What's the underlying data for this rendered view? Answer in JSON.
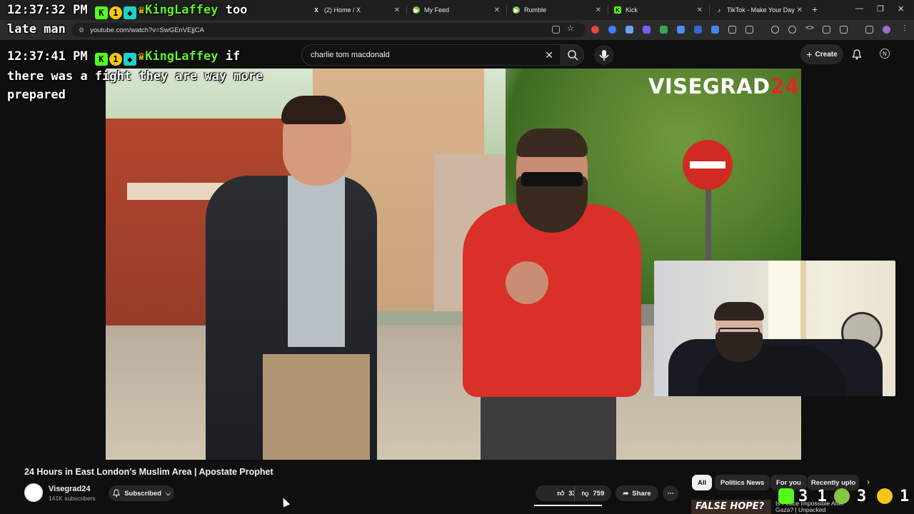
{
  "tabs": [
    {
      "label": "(2) Home / X",
      "icon": "x-icon"
    },
    {
      "label": "My Feed",
      "icon": "rumble-icon"
    },
    {
      "label": "Rumble",
      "icon": "rumble-icon"
    },
    {
      "label": "Kick",
      "icon": "kick-icon"
    },
    {
      "label": "TikTok - Make Your Day",
      "icon": "tiktok-icon"
    }
  ],
  "address": {
    "url": "youtube.com/watch?v=SwGEnVEjjCA"
  },
  "search": {
    "query": "charlie tom macdonald"
  },
  "header": {
    "create_label": "Create",
    "account_initial": "N"
  },
  "chat": [
    {
      "time": "12:37:32 PM",
      "user": "KingLaffey",
      "text": "too",
      "continuation": "late man"
    },
    {
      "time": "12:37:41 PM",
      "user": "KingLaffey",
      "text": "if",
      "continuation1": "there was a fight they are way more",
      "continuation2": "prepared"
    }
  ],
  "video": {
    "watermark_text": "VISEGRAD",
    "watermark_num": "24",
    "title": "24 Hours in East London's Muslim Area | Apostate Prophet"
  },
  "channel": {
    "name": "Visegrad24",
    "subscribers": "141K subscribers",
    "subscribe_label": "Subscribed"
  },
  "actions": {
    "likes": "33K",
    "dislikes": "759",
    "share_label": "Share"
  },
  "chips": [
    "All",
    "Politics News",
    "For you",
    "Recently uplo"
  ],
  "sidebar_video": {
    "thumb_text": "FALSE HOPE?",
    "title": "Is Peace Impossible After Gaza? | Unpacked"
  },
  "counters": {
    "kick": "3 1",
    "rumble": "3",
    "other": "1"
  },
  "colors": {
    "accent_red": "#d72b24",
    "kick_green": "#53fc18",
    "bg": "#0f0f0f"
  }
}
